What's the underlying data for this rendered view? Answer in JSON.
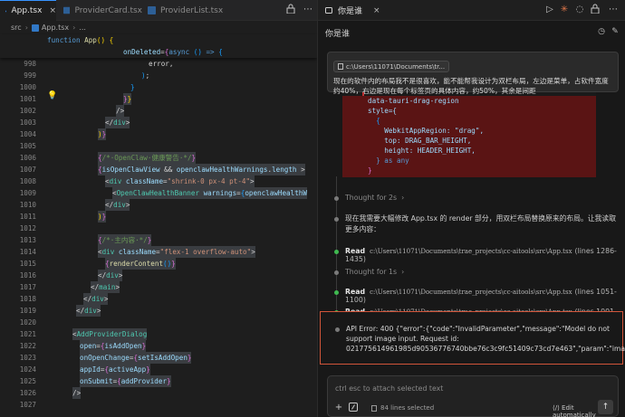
{
  "editor": {
    "tabs": [
      {
        "label": "App.tsx",
        "active": true
      },
      {
        "label": "ProviderCard.tsx",
        "active": false
      },
      {
        "label": "ProviderList.tsx",
        "active": false
      }
    ],
    "breadcrumb": {
      "folder": "src",
      "file": "App.tsx",
      "more": "..."
    },
    "sticky": {
      "line1": "function App() {",
      "line2": "onDeleted={async () => {"
    },
    "line_numbers": [
      "998",
      "999",
      "1000",
      "1001",
      "1002",
      "1003",
      "1004",
      "1005",
      "1006",
      "1007",
      "1008",
      "1009",
      "1010",
      "1011",
      "1012",
      "1013",
      "1014",
      "1015",
      "1016",
      "1017",
      "1018",
      "1019",
      "1020",
      "1021",
      "1022",
      "1023",
      "1024",
      "1025",
      "1026",
      "1027"
    ]
  },
  "chat": {
    "tab_label": "你是谁",
    "title": "你是谁",
    "user_message": {
      "file_chip": "c:\\Users\\11071\\Documents\\tr...",
      "text": "现在的软件内的布局我不是很喜欢，能不能帮我设计为双栏布局，左边是菜单，占软件宽度约40%，右边是现在每个标签页的具体内容，约50%，其余是间距"
    },
    "diff_lines": [
      "data-tauri-drag-region",
      "style={",
      "  {",
      "    WebkitAppRegion: \"drag\",",
      "    top: DRAG_BAR_HEIGHT,",
      "    height: HEADER_HEIGHT,",
      "  } as any",
      "}",
      ">"
    ],
    "timeline": {
      "thought1": "Thought for 2s",
      "message": "现在我需要大幅修改 App.tsx 的 render 部分，用双栏布局替换原来的布局。让我读取更多内容：",
      "read1": {
        "label": "Read",
        "path": "c:\\Users\\11071\\Documents\\trae_projects\\cc-aitools\\src\\App.tsx",
        "lines": "(lines 1286-1435)"
      },
      "thought2": "Thought for 1s",
      "read2": {
        "label": "Read",
        "path": "c:\\Users\\11071\\Documents\\trae_projects\\cc-aitools\\src\\App.tsx",
        "lines": "(lines 1051-1100)"
      },
      "read3": {
        "label": "Read",
        "path": "c:\\Users\\11071\\Documents\\trae_projects\\cc-aitools\\src\\App.tsx",
        "lines": "(lines 1001-1100)"
      }
    },
    "error": "API Error: 400 {\"error\":{\"code\":\"InvalidParameter\",\"message\":\"Model do not support image input. Request id: 021775614961985d90536776740bbe76c3c9fc51409c73cd7e463\",\"param\":\"image_url\",",
    "composer": {
      "placeholder": "ctrl esc to attach selected text",
      "lines_selected": "84 lines selected",
      "edit_mode": "Edit automatically"
    }
  },
  "colors": {
    "accent": "#3794ff",
    "error_border": "#d2553a",
    "diff_removed": "#5a1414"
  }
}
